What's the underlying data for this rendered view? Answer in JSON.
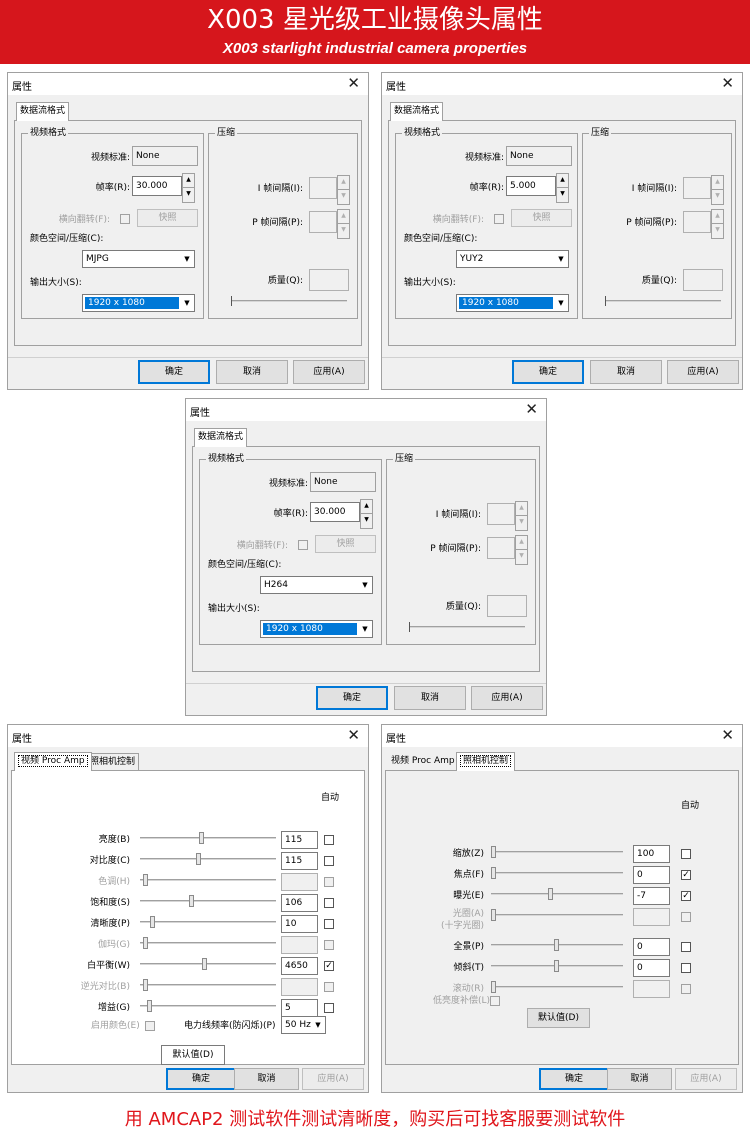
{
  "banner": {
    "title": "X003 星光级工业摄像头属性",
    "subtitle": "X003 starlight industrial camera properties"
  },
  "footer": {
    "text": "用 AMCAP2 测试软件测试清晰度，购买后可找客服要测试软件"
  },
  "close_glyph": "✕",
  "format_dialogs": [
    {
      "title": "属性",
      "tab": "数据流格式",
      "video_group": "视频格式",
      "compress_group": "压缩",
      "standard_label": "视频标准:",
      "standard_value": "None",
      "framerate_label": "帧率(R):",
      "framerate_value": "30.000",
      "flip_label": "横向翻转(F):",
      "snapshot_label": "快照",
      "color_label": "颜色空间/压缩(C):",
      "color_value": "MJPG",
      "size_label": "输出大小(S):",
      "size_value": "1920 x 1080",
      "iframe_label": "I 帧间隔(I):",
      "pframe_label": "P 帧间隔(P):",
      "quality_label": "质量(Q):",
      "ok": "确定",
      "cancel": "取消",
      "apply": "应用(A)"
    },
    {
      "title": "属性",
      "tab": "数据流格式",
      "video_group": "视频格式",
      "compress_group": "压缩",
      "standard_label": "视频标准:",
      "standard_value": "None",
      "framerate_label": "帧率(R):",
      "framerate_value": "5.000",
      "flip_label": "横向翻转(F):",
      "snapshot_label": "快照",
      "color_label": "颜色空间/压缩(C):",
      "color_value": "YUY2",
      "size_label": "输出大小(S):",
      "size_value": "1920 x 1080",
      "iframe_label": "I 帧间隔(I):",
      "pframe_label": "P 帧间隔(P):",
      "quality_label": "质量(Q):",
      "ok": "确定",
      "cancel": "取消",
      "apply": "应用(A)"
    },
    {
      "title": "属性",
      "tab": "数据流格式",
      "video_group": "视频格式",
      "compress_group": "压缩",
      "standard_label": "视频标准:",
      "standard_value": "None",
      "framerate_label": "帧率(R):",
      "framerate_value": "30.000",
      "flip_label": "横向翻转(F):",
      "snapshot_label": "快照",
      "color_label": "颜色空间/压缩(C):",
      "color_value": "H264",
      "size_label": "输出大小(S):",
      "size_value": "1920 x 1080",
      "iframe_label": "I 帧间隔(I):",
      "pframe_label": "P 帧间隔(P):",
      "quality_label": "质量(Q):",
      "ok": "确定",
      "cancel": "取消",
      "apply": "应用(A)"
    }
  ],
  "procamp": {
    "title": "属性",
    "tab_active": "视频 Proc Amp",
    "tab_other": "照相机控制",
    "auto_header": "自动",
    "rows": [
      {
        "label": "亮度(B)",
        "value": "115",
        "enabled": true,
        "auto": false,
        "level": 0.45
      },
      {
        "label": "对比度(C)",
        "value": "115",
        "enabled": true,
        "auto": false,
        "level": 0.43
      },
      {
        "label": "色调(H)",
        "value": "",
        "enabled": false,
        "auto": false,
        "level": 0.02
      },
      {
        "label": "饱和度(S)",
        "value": "106",
        "enabled": true,
        "auto": false,
        "level": 0.38
      },
      {
        "label": "清晰度(P)",
        "value": "10",
        "enabled": true,
        "auto": false,
        "level": 0.08
      },
      {
        "label": "伽玛(G)",
        "value": "",
        "enabled": false,
        "auto": false,
        "level": 0.02
      },
      {
        "label": "白平衡(W)",
        "value": "4650",
        "enabled": true,
        "auto": true,
        "level": 0.48
      },
      {
        "label": "逆光对比(B)",
        "value": "",
        "enabled": false,
        "auto": false,
        "level": 0.02
      },
      {
        "label": "增益(G)",
        "value": "5",
        "enabled": true,
        "auto": false,
        "level": 0.05
      }
    ],
    "color_enable_label": "启用颜色(E)",
    "powerline_label": "电力线频率(防闪烁)(P)",
    "powerline_value": "50 Hz",
    "default_button": "默认值(D)",
    "ok": "确定",
    "cancel": "取消",
    "apply": "应用(A)"
  },
  "camera": {
    "title": "属性",
    "tab_other": "视频 Proc Amp",
    "tab_active": "照相机控制",
    "auto_header": "自动",
    "rows": [
      {
        "label": "缩放(Z)",
        "value": "100",
        "enabled": true,
        "auto": false,
        "level": 0.0
      },
      {
        "label": "焦点(F)",
        "value": "0",
        "enabled": true,
        "auto": true,
        "level": 0.0
      },
      {
        "label": "曝光(E)",
        "value": "-7",
        "enabled": true,
        "auto": true,
        "level": 0.45
      },
      {
        "label": "光圈(A)",
        "label2": "(十字光圈)",
        "value": "",
        "enabled": false,
        "auto": false,
        "level": 0.0
      },
      {
        "label": "全景(P)",
        "value": "0",
        "enabled": true,
        "auto": false,
        "level": 0.5
      },
      {
        "label": "倾斜(T)",
        "value": "0",
        "enabled": true,
        "auto": false,
        "level": 0.5
      },
      {
        "label": "滚动(R)",
        "value": "",
        "enabled": false,
        "auto": false,
        "level": 0.0
      }
    ],
    "lowlight_label": "低亮度补偿(L)",
    "default_button": "默认值(D)",
    "ok": "确定",
    "cancel": "取消",
    "apply": "应用(A)"
  }
}
